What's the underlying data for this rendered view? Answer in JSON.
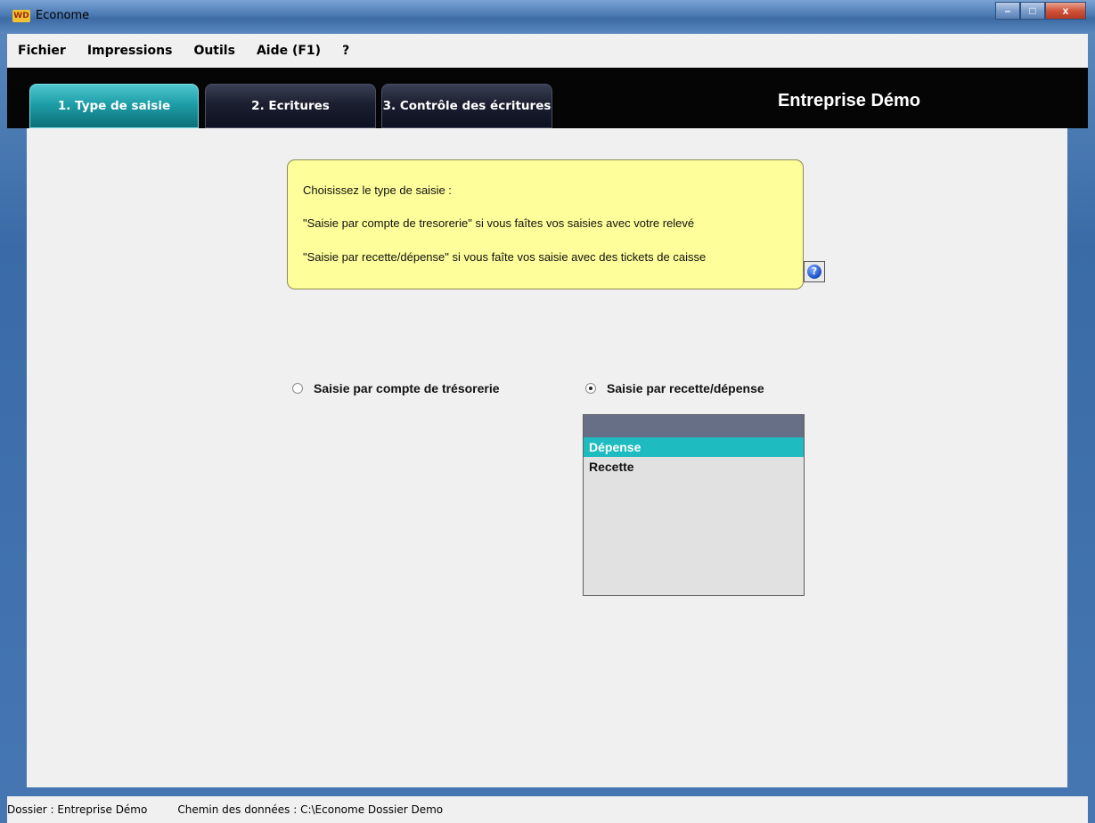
{
  "window": {
    "title": "Econome",
    "icon": "app-logo-icon",
    "icon_text": "WD",
    "buttons": {
      "minimize": "–",
      "maximize": "□",
      "close": "x"
    }
  },
  "menubar": {
    "items": [
      "Fichier",
      "Impressions",
      "Outils",
      "Aide (F1)",
      "?"
    ]
  },
  "tabs": [
    {
      "label": "1. Type de saisie",
      "active": true
    },
    {
      "label": "2. Ecritures",
      "active": false
    },
    {
      "label": "3. Contrôle des écritures",
      "active": false
    }
  ],
  "company_title": "Entreprise Démo",
  "info_box": {
    "lines": [
      "Choisissez le type de saisie :",
      "\"Saisie par compte de tresorerie\" si vous faîtes vos saisies avec votre relevé",
      "\"Saisie par recette/dépense\" si vous faîte vos saisie avec des tickets de caisse"
    ],
    "color": "#fefe9a"
  },
  "help_button": {
    "icon": "help-question-icon",
    "glyph": "?"
  },
  "radio_options": [
    {
      "label": "Saisie par compte de trésorerie",
      "checked": false
    },
    {
      "label": "Saisie par recette/dépense",
      "checked": true
    }
  ],
  "listbox": {
    "items": [
      "Dépense",
      "Recette"
    ],
    "selected": "Dépense",
    "selection_color": "#1ebcc0"
  },
  "statusbar": {
    "dossier": "Dossier : Entreprise Démo",
    "path": "Chemin des données : C:\\Econome Dossier Demo"
  },
  "colors": {
    "active_tab": "#1e9ea8",
    "header_bg": "#050505"
  }
}
